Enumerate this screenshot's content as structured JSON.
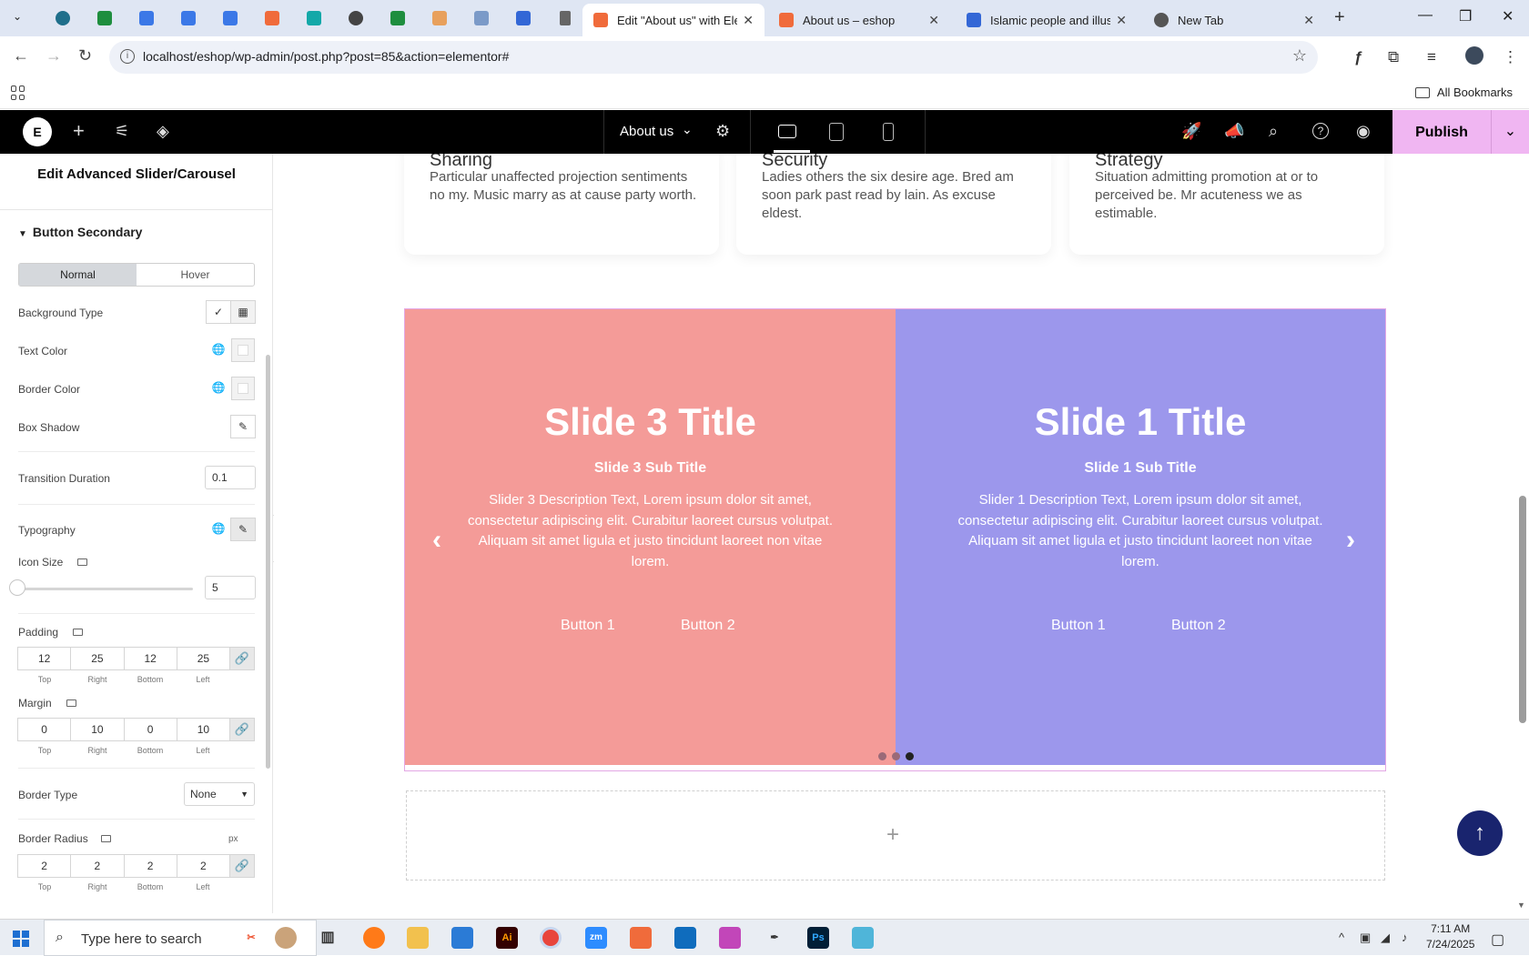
{
  "browser": {
    "tabs": [
      {
        "label": "Edit \"About us\" with Elem",
        "color": "#f06b3b"
      },
      {
        "label": "About us – eshop",
        "color": "#f06b3b"
      },
      {
        "label": "Islamic people and illustr",
        "color": "#3367d6"
      },
      {
        "label": "New Tab",
        "color": "#555555"
      }
    ],
    "url": "localhost/eshop/wp-admin/post.php?post=85&action=elementor#",
    "bookmarks_label": "All Bookmarks"
  },
  "editor": {
    "logo": "E",
    "page_name": "About us",
    "publish_label": "Publish",
    "accent": "#f0b6f2"
  },
  "panel": {
    "title": "Edit Advanced Slider/Carousel",
    "section": "Button Secondary",
    "state_tabs": [
      "Normal",
      "Hover"
    ],
    "background_type_label": "Background Type",
    "text_color_label": "Text Color",
    "border_color_label": "Border Color",
    "box_shadow_label": "Box Shadow",
    "transition_duration_label": "Transition Duration",
    "transition_duration_value": "0.1",
    "typography_label": "Typography",
    "icon_size_label": "Icon Size",
    "icon_size_value": "5",
    "padding_label": "Padding",
    "padding": [
      "12",
      "25",
      "12",
      "25"
    ],
    "margin_label": "Margin",
    "margin": [
      "0",
      "10",
      "0",
      "10"
    ],
    "dim_labels": [
      "Top",
      "Right",
      "Bottom",
      "Left"
    ],
    "border_type_label": "Border Type",
    "border_type_value": "None",
    "border_radius_label": "Border Radius",
    "border_radius_unit": "px",
    "border_radius": [
      "2",
      "2",
      "2",
      "2"
    ]
  },
  "canvas": {
    "cards": [
      {
        "title": "Sharing",
        "text": "Particular unaffected projection sentiments no my. Music marry as at cause party worth."
      },
      {
        "title": "Security",
        "text": "Ladies others the six desire age. Bred am soon park past read by lain. As excuse eldest."
      },
      {
        "title": "Strategy",
        "text": "Situation admitting promotion at or to perceived be. Mr acuteness we as estimable."
      }
    ],
    "slides": [
      {
        "title": "Slide 3 Title",
        "subtitle": "Slide 3 Sub Title",
        "desc": "Slider 3 Description Text, Lorem ipsum dolor sit amet, consectetur adipiscing elit. Curabitur laoreet cursus volutpat. Aliquam sit amet ligula et justo tincidunt laoreet non vitae lorem.",
        "button1": "Button 1",
        "button2": "Button 2",
        "color": "#f49b98"
      },
      {
        "title": "Slide 1 Title",
        "subtitle": "Slide 1 Sub Title",
        "desc": "Slider 1 Description Text, Lorem ipsum dolor sit amet, consectetur adipiscing elit. Curabitur laoreet cursus volutpat. Aliquam sit amet ligula et justo tincidunt laoreet non vitae lorem.",
        "button1": "Button 1",
        "button2": "Button 2",
        "color": "#9c97ec"
      }
    ],
    "add_label": "+"
  },
  "taskbar": {
    "search_placeholder": "Type here to search",
    "time": "7:11 AM",
    "date": "7/24/2025"
  }
}
